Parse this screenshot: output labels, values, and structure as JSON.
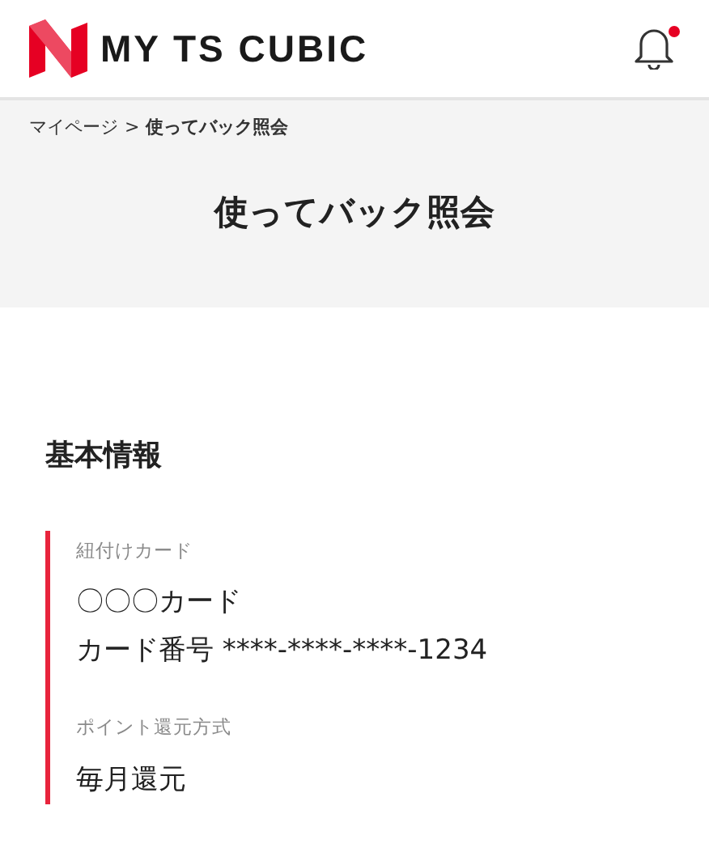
{
  "header": {
    "logo_text": "MY TS CUBIC",
    "notifications": {
      "unread": true
    }
  },
  "breadcrumb": {
    "items": [
      {
        "label": "マイページ",
        "current": false
      },
      {
        "label": "使ってバック照会",
        "current": true
      }
    ],
    "separator": ">"
  },
  "page_title": "使ってバック照会",
  "section": {
    "title": "基本情報",
    "fields": [
      {
        "label": "紐付けカード",
        "values": [
          "〇〇〇カード",
          "カード番号 ****-****-****-1234"
        ]
      },
      {
        "label": "ポイント還元方式",
        "values": [
          "毎月還元"
        ]
      }
    ]
  }
}
